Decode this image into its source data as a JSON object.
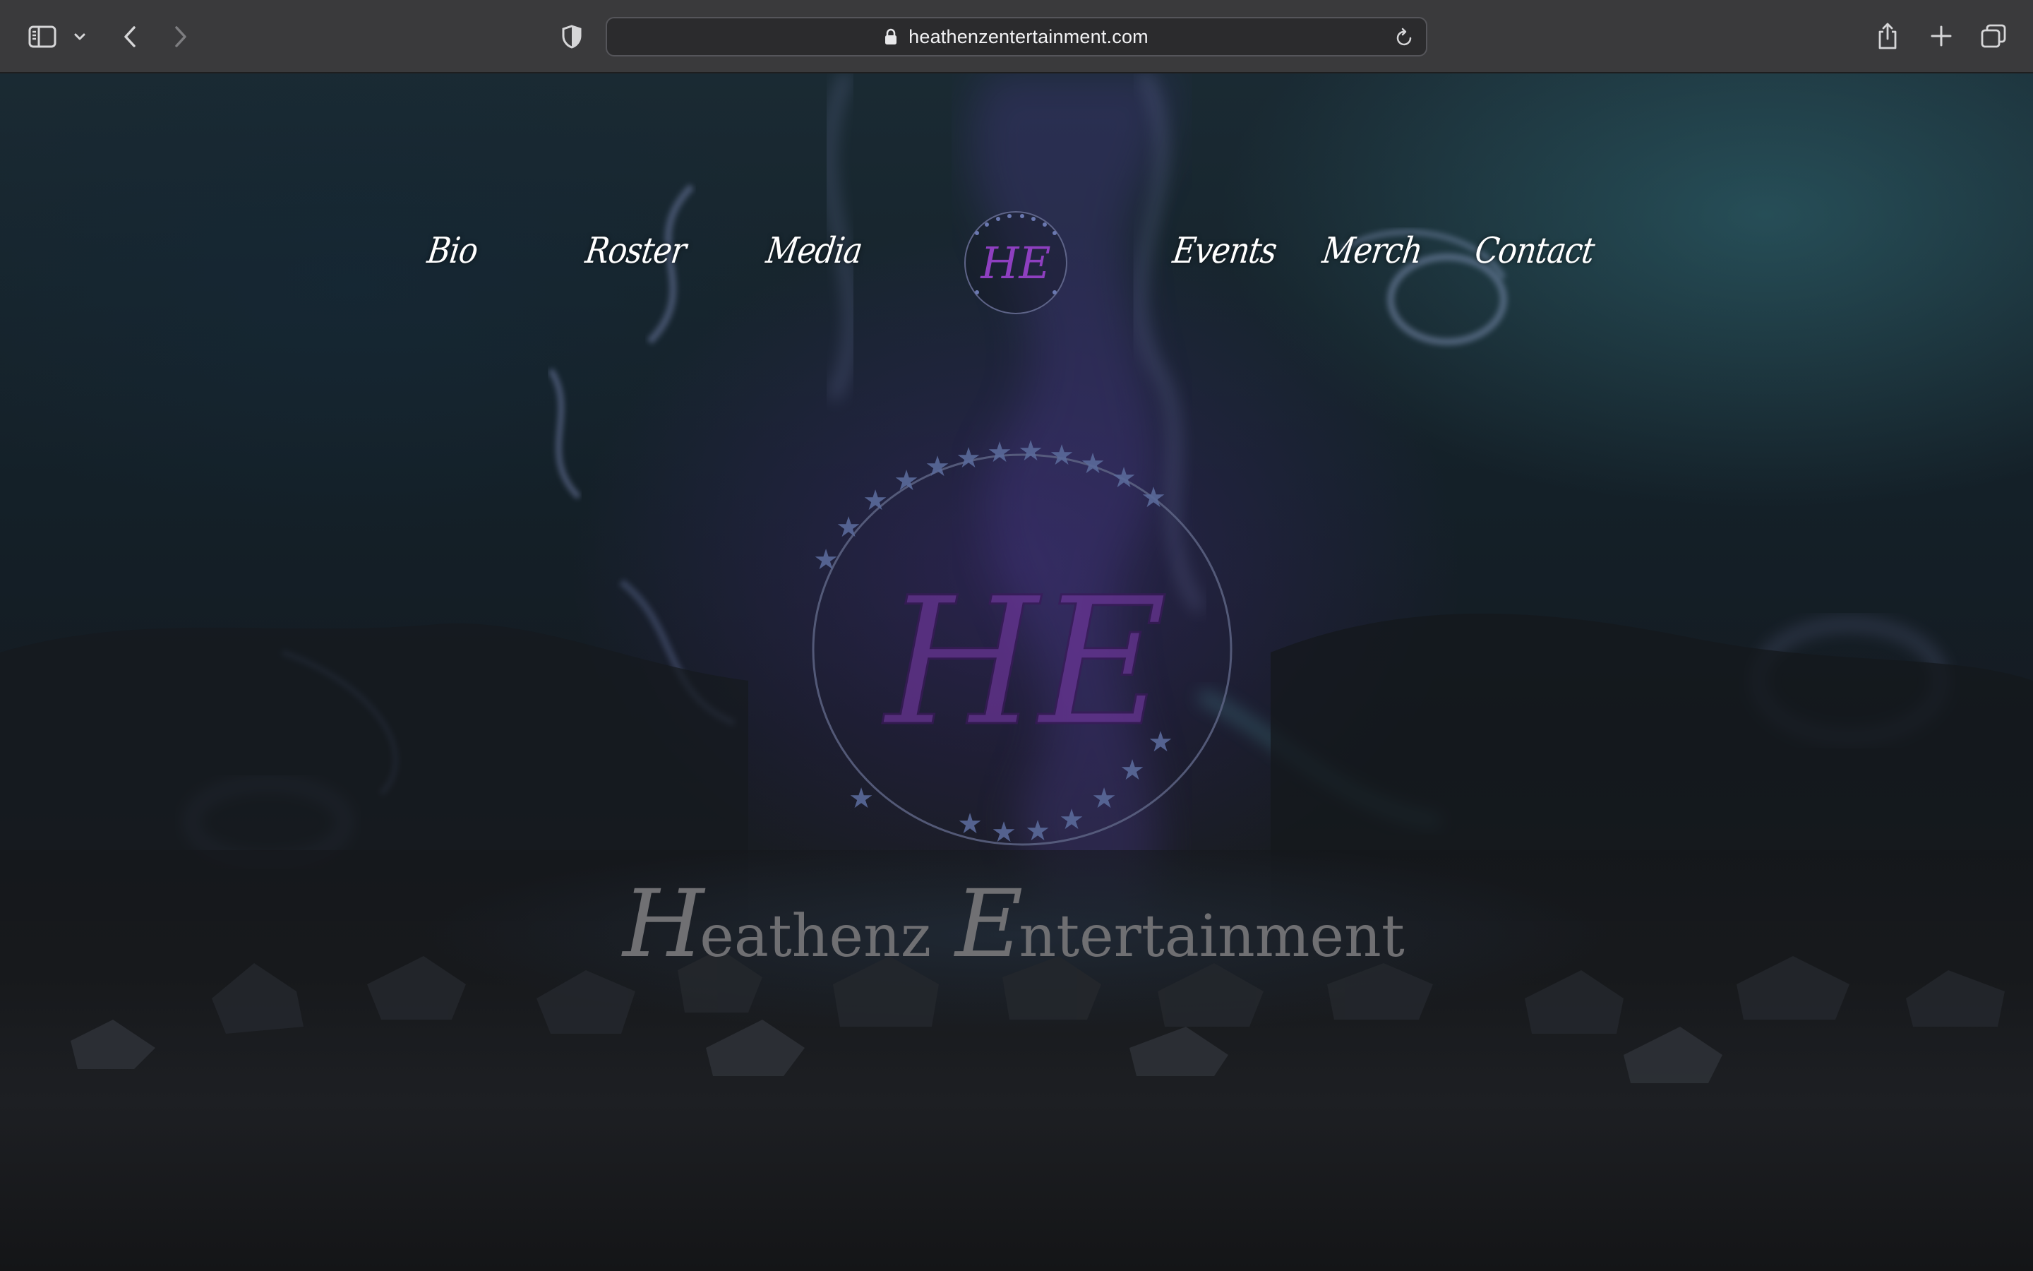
{
  "browser": {
    "url": "heathenzentertainment.com",
    "icons": {
      "sidebar": "sidebar-icon",
      "sidebar_menu": "chevron-down-icon",
      "back": "chevron-left-icon",
      "forward": "chevron-right-icon",
      "privacy": "shield-icon",
      "lock": "lock-icon",
      "reload": "reload-icon",
      "share": "share-icon",
      "new_tab": "plus-icon",
      "tab_overview": "tabs-icon"
    }
  },
  "nav": {
    "items": [
      {
        "label": "Bio"
      },
      {
        "label": "Roster"
      },
      {
        "label": "Media"
      },
      {
        "label": "Events"
      },
      {
        "label": "Merch"
      },
      {
        "label": "Contact"
      }
    ],
    "logo_monogram": "HE"
  },
  "hero": {
    "monogram": "HE",
    "brand_cap_1": "H",
    "brand_rest_1": "eathenz",
    "brand_cap_2": "E",
    "brand_rest_2": "ntertainment"
  },
  "colors": {
    "toolbar": "#3a3a3c",
    "monogram_purple": "#7a3fa8",
    "brand_gray": "#6f6f72",
    "star_blue": "#5a6a9a"
  }
}
